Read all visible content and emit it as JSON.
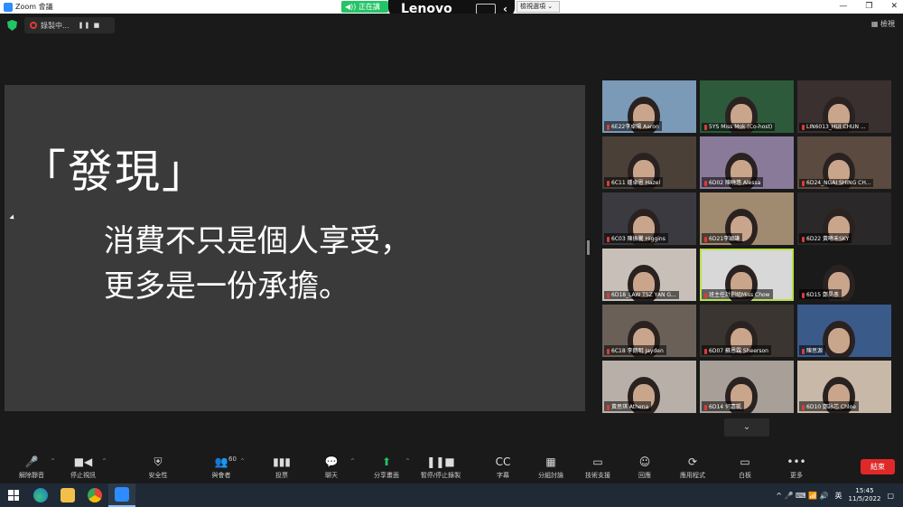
{
  "window": {
    "title": "Zoom 會議",
    "controls": [
      "—",
      "❐",
      "✕"
    ]
  },
  "overlay": {
    "speaking": "◀)) 正在講話：",
    "brand": "Lenovo",
    "view_options": "檢視選項 ⌄"
  },
  "meeting": {
    "recording_label": "錄製中...",
    "recording_controls": "❚❚ ■",
    "view_label": "檢視"
  },
  "slide": {
    "heading": "「發現」",
    "line1": "消費不只是個人享受，",
    "line2": "更多是一份承擔。"
  },
  "participants": [
    {
      "name": "6E22李卓陽 Aaron",
      "bg": "#7a9ab8"
    },
    {
      "name": "5YS Miss Mok (Co-host)",
      "bg": "#2d5a3a"
    },
    {
      "name": "LIN6013_HUI CHUN ...",
      "bg": "#3a3030"
    },
    {
      "name": "6C11 鍾卓恩 Hazel",
      "bg": "#4a4038"
    },
    {
      "name": "6D02 陳曉悠 Alessa",
      "bg": "#8a7a9a"
    },
    {
      "name": "6D24_NGAI SHING CH...",
      "bg": "#5a4a40"
    },
    {
      "name": "6C03 陳振騰 Higgins",
      "bg": "#3a3a40"
    },
    {
      "name": "6D21李穎謙",
      "bg": "#a08a70"
    },
    {
      "name": "6D22 黃曦禾SKY",
      "bg": "#2a2828"
    },
    {
      "name": "6D18_LAW TSZ YAN G...",
      "bg": "#c8c0b8"
    },
    {
      "name": "班主任計劃組Miss Chow",
      "bg": "#d8d8d8"
    },
    {
      "name": "6D15 鄭昊彥",
      "bg": "#1a1a1a"
    },
    {
      "name": "6C18 李朗明 Jayden",
      "bg": "#6a6058"
    },
    {
      "name": "6D07 蘇恩霖 Sheerson",
      "bg": "#3a3530"
    },
    {
      "name": "陳思源",
      "bg": "#3a5a8a"
    },
    {
      "name": "黃思琪 Athena",
      "bg": "#b8b0a8"
    },
    {
      "name": "6D14 何嘉凱",
      "bg": "#a8a098"
    },
    {
      "name": "6D10 鄭詠芯 Chloe",
      "bg": "#c8b8a8"
    }
  ],
  "toolbar": [
    {
      "label": "解除靜音",
      "icon": "🎤",
      "name": "unmute"
    },
    {
      "label": "停止視訊",
      "icon": "■◀",
      "name": "stop-video"
    },
    {
      "label": "安全性",
      "icon": "⛨",
      "name": "security"
    },
    {
      "label": "與會者",
      "icon": "👥",
      "name": "participants",
      "count": "60"
    },
    {
      "label": "投票",
      "icon": "▮▮▮",
      "name": "polls"
    },
    {
      "label": "聊天",
      "icon": "💬",
      "name": "chat"
    },
    {
      "label": "分享畫面",
      "icon": "⬆",
      "name": "share-screen"
    },
    {
      "label": "暫停/停止錄製",
      "icon": "❚❚■",
      "name": "pause-stop-recording"
    },
    {
      "label": "字幕",
      "icon": "CC",
      "name": "captions"
    },
    {
      "label": "分組討論",
      "icon": "▦",
      "name": "breakout-rooms"
    },
    {
      "label": "技術支援",
      "icon": "▭",
      "name": "tech-support"
    },
    {
      "label": "回應",
      "icon": "☺",
      "name": "reactions"
    },
    {
      "label": "應用程式",
      "icon": "⟳",
      "name": "apps"
    },
    {
      "label": "白板",
      "icon": "▭",
      "name": "whiteboard"
    },
    {
      "label": "更多",
      "icon": "•••",
      "name": "more"
    }
  ],
  "end_button": "結束",
  "scroll_down": "⌄",
  "taskbar": {
    "ime": "英",
    "time": "15:45",
    "date": "11/5/2022",
    "tray_icons": "^ 🎤 ⌨ 📶 🔊"
  }
}
